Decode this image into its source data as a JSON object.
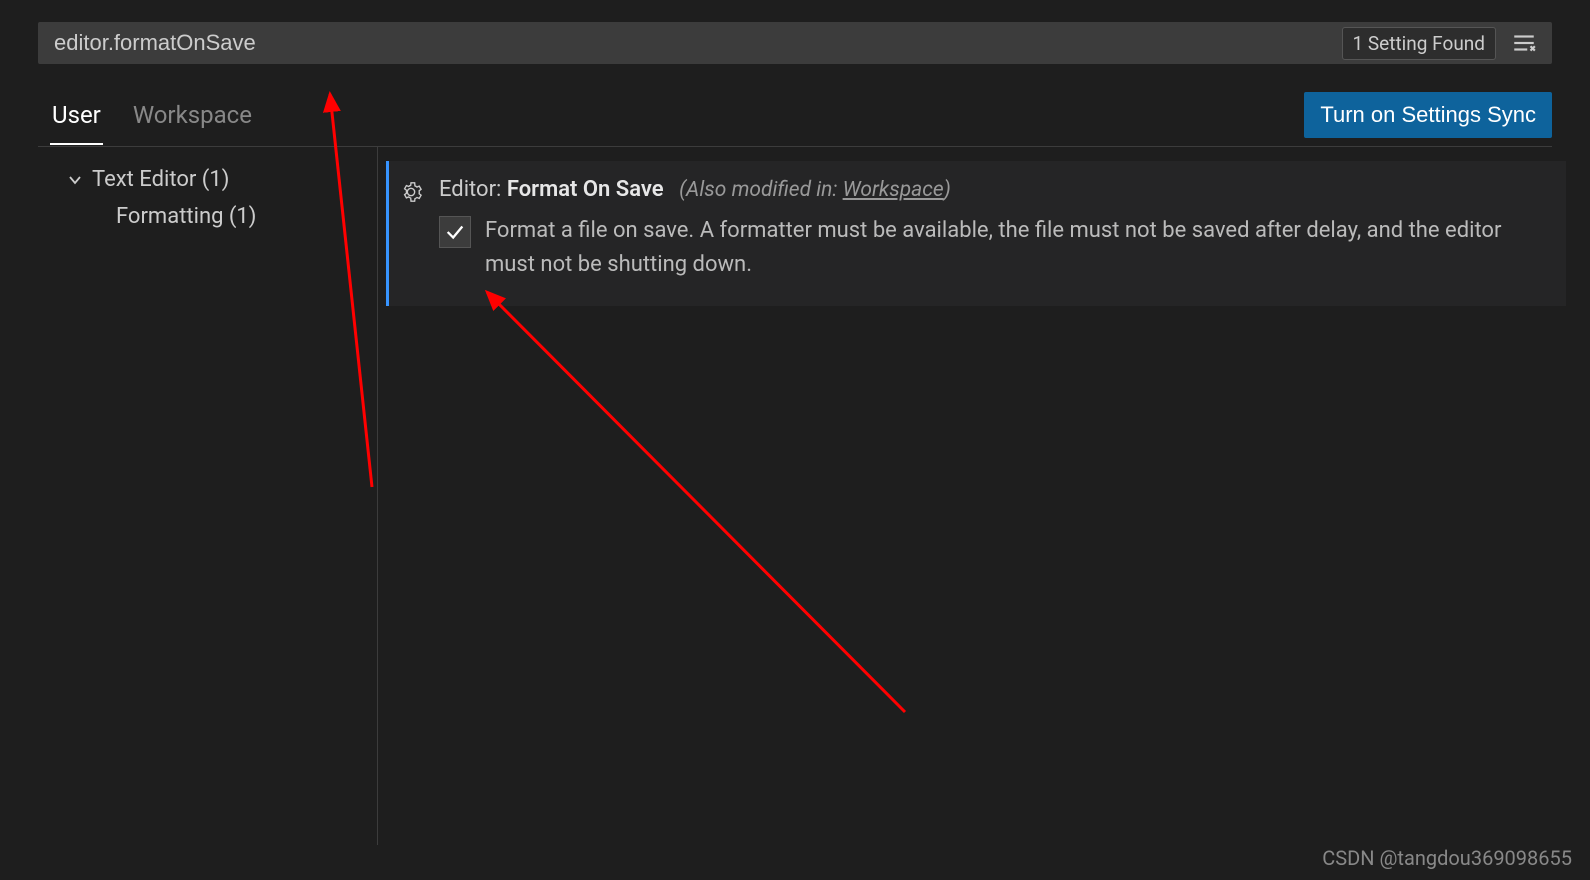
{
  "search": {
    "value": "editor.formatOnSave",
    "results_label": "1 Setting Found"
  },
  "tabs": {
    "user": "User",
    "workspace": "Workspace"
  },
  "sync_button": "Turn on Settings Sync",
  "sidebar": {
    "text_editor": "Text Editor (1)",
    "formatting": "Formatting (1)"
  },
  "setting": {
    "category": "Editor:",
    "name": "Format On Save",
    "modified_prefix": "(Also modified in: ",
    "modified_link": "Workspace",
    "modified_suffix": ")",
    "description": "Format a file on save. A formatter must be available, the file must not be saved after delay, and the editor must not be shutting down.",
    "checked": true
  },
  "watermark": "CSDN @tangdou369098655",
  "colors": {
    "accent": "#0e639c",
    "modified_indicator": "#3794ff",
    "annotation": "#ff0000"
  }
}
